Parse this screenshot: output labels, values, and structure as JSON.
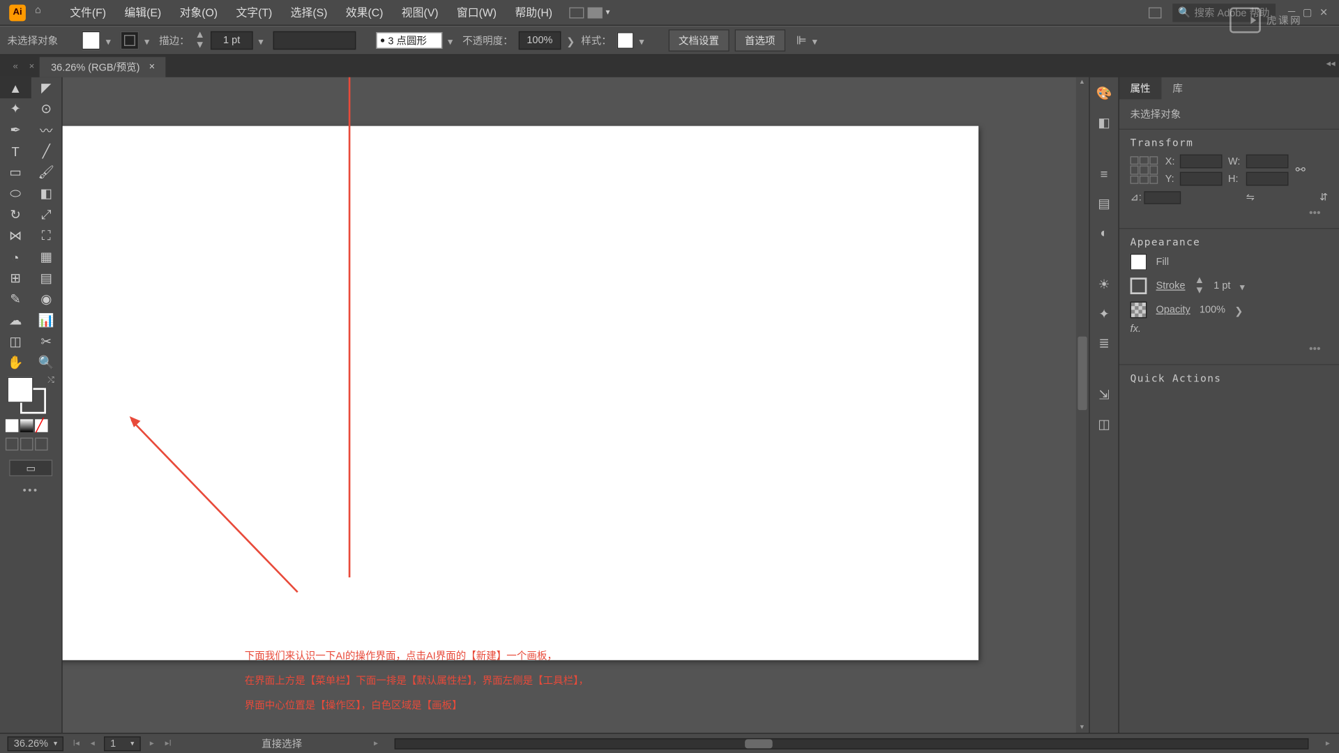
{
  "app": {
    "letters": "Ai"
  },
  "menu": {
    "file": "文件(F)",
    "edit": "编辑(E)",
    "object": "对象(O)",
    "type": "文字(T)",
    "select": "选择(S)",
    "effect": "效果(C)",
    "view": "视图(V)",
    "window": "窗口(W)",
    "help": "帮助(H)"
  },
  "search": {
    "placeholder": "搜索 Adobe 帮助"
  },
  "control": {
    "no_sel": "未选择对象",
    "stroke_lbl": "描边：",
    "stroke_val": "1 pt",
    "brush_def": "3 点圆形",
    "opacity_lbl": "不透明度：",
    "opacity_val": "100%",
    "style_lbl": "样式：",
    "doc_setup": "文档设置",
    "prefs": "首选项"
  },
  "tab": {
    "title": "36.26% (RGB/预览)",
    "close": "×"
  },
  "canvas_text": {
    "l1": "下面我们来认识一下AI的操作界面，点击AI界面的【新建】一个画板，",
    "l2": "在界面上方是【菜单栏】下面一排是【默认属性栏】，界面左侧是【工具栏】，",
    "l3": "界面中心位置是【操作区】，白色区域是【画板】"
  },
  "prop": {
    "tab_prop": "属性",
    "tab_lib": "库",
    "nosel": "未选择对象",
    "transform": "Transform",
    "x": "X:",
    "y": "Y:",
    "w": "W:",
    "h": "H:",
    "angle": "⊿:",
    "appearance": "Appearance",
    "fill": "Fill",
    "stroke": "Stroke",
    "stroke_v": "1 pt",
    "opacity": "Opacity",
    "opac_v": "100%",
    "fx": "fx.",
    "quick": "Quick Actions"
  },
  "status": {
    "zoom": "36.26%",
    "artboard": "1",
    "hint": "直接选择"
  },
  "watermark": "虎课网"
}
